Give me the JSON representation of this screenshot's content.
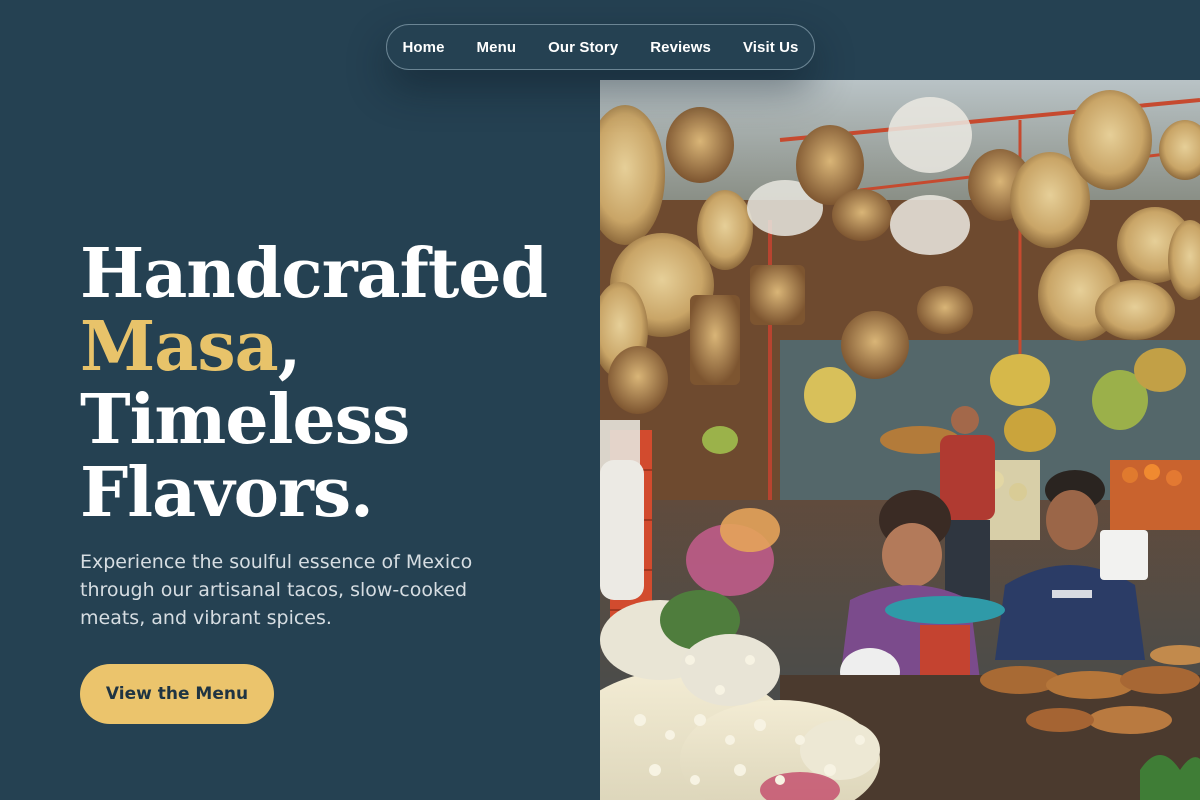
{
  "nav": {
    "items": [
      {
        "label": "Home"
      },
      {
        "label": "Menu"
      },
      {
        "label": "Our Story"
      },
      {
        "label": "Reviews"
      },
      {
        "label": "Visit Us"
      }
    ]
  },
  "hero": {
    "title_line1": "Handcrafted",
    "title_accent": "Masa",
    "title_comma": ",",
    "title_line3": "Timeless",
    "title_line4": "Flavors.",
    "subtitle": "Experience the soulful essence of Mexico through our artisanal tacos, slow-cooked meats, and vibrant spices.",
    "cta_label": "View the Menu"
  },
  "photo": {
    "subject": "mexican-market-baskets-flowers-icon"
  },
  "colors": {
    "background": "#254152",
    "accent": "#e8c36a",
    "button": "#ebc46c",
    "text": "#ffffff"
  }
}
